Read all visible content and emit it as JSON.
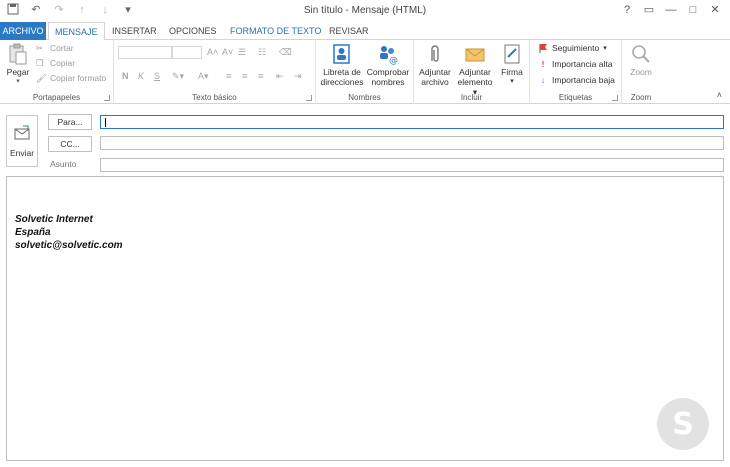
{
  "window": {
    "title": "Sin título - Mensaje (HTML)",
    "controls": [
      "?",
      "▭",
      "—",
      "□",
      "✕"
    ]
  },
  "tabs": [
    {
      "label": "ARCHIVO"
    },
    {
      "label": "MENSAJE"
    },
    {
      "label": "INSERTAR"
    },
    {
      "label": "OPCIONES"
    },
    {
      "label": "FORMATO DE TEXTO"
    },
    {
      "label": "REVISAR"
    }
  ],
  "ribbon": {
    "portapapeles": {
      "label": "Portapapeles",
      "paste": "Pegar",
      "cut": "Cortar",
      "copy": "Copiar",
      "format_painter": "Copiar formato"
    },
    "texto_basico": {
      "label": "Texto básico",
      "bold": "N",
      "italic": "K",
      "underline": "S"
    },
    "nombres": {
      "label": "Nombres",
      "address_book_l1": "Libreta de",
      "address_book_l2": "direcciones",
      "check_names_l1": "Comprobar",
      "check_names_l2": "nombres"
    },
    "incluir": {
      "label": "Incluir",
      "attach_file_l1": "Adjuntar",
      "attach_file_l2": "archivo",
      "attach_item_l1": "Adjuntar",
      "attach_item_l2": "elemento",
      "signature": "Firma"
    },
    "etiquetas": {
      "label": "Etiquetas",
      "follow_up": "Seguimiento",
      "high_importance": "Importancia alta",
      "low_importance": "Importancia baja"
    },
    "zoom": {
      "label": "Zoom",
      "zoom": "Zoom"
    }
  },
  "compose": {
    "send": "Enviar",
    "to_button": "Para...",
    "cc_button": "CC...",
    "subject_label": "Asunto",
    "to_value": "",
    "cc_value": "",
    "subject_value": ""
  },
  "signature": {
    "line1": "Solvetic Internet",
    "line2": "España",
    "line3": "solvetic@solvetic.com"
  },
  "colors": {
    "accent": "#2b78c5",
    "follow_flag": "#d9453d",
    "high_importance": "#d9453d",
    "low_importance": "#2b78c5"
  }
}
